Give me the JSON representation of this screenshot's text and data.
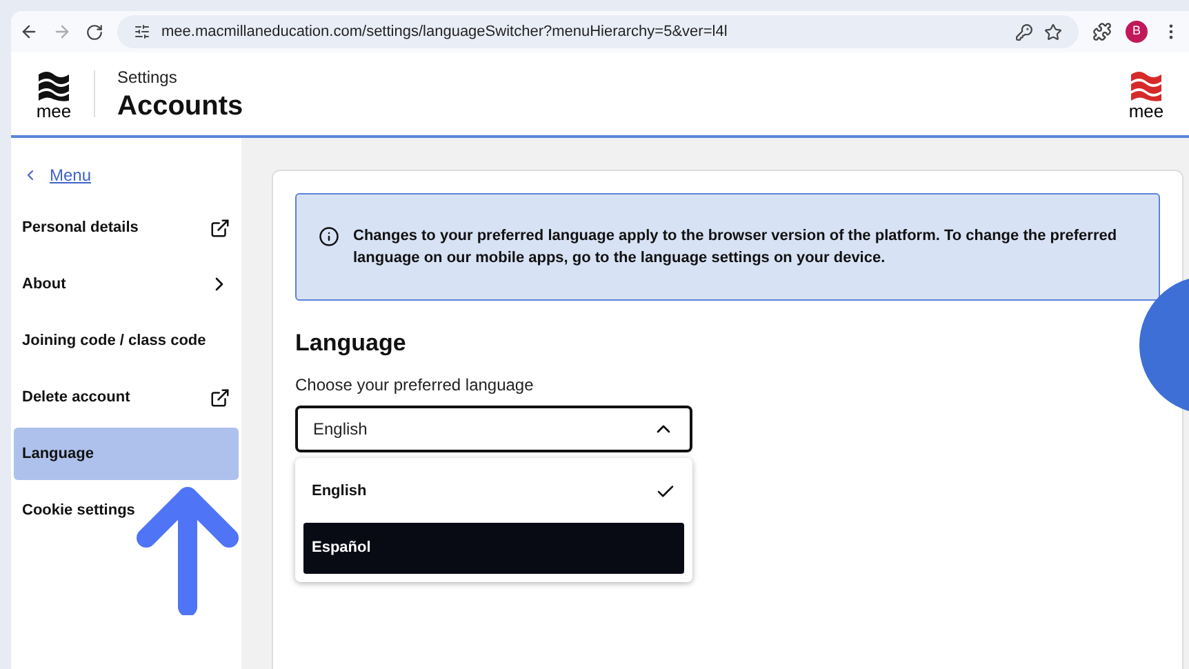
{
  "browser": {
    "url": "mee.macmillaneducation.com/settings/languageSwitcher?menuHierarchy=5&ver=l4l",
    "profile": "B"
  },
  "header": {
    "logo_text": "mee",
    "subtitle": "Settings",
    "title": "Accounts",
    "brand_text": "mee"
  },
  "sidebar": {
    "back": "Menu",
    "items": [
      {
        "label": "Personal details",
        "kind": "external",
        "selected": false
      },
      {
        "label": "About",
        "kind": "chevron",
        "selected": false
      },
      {
        "label": "Joining code / class code",
        "kind": "plain",
        "selected": false
      },
      {
        "label": "Delete account",
        "kind": "external",
        "selected": false
      },
      {
        "label": "Language",
        "kind": "plain",
        "selected": true
      },
      {
        "label": "Cookie settings",
        "kind": "plain",
        "selected": false
      }
    ]
  },
  "notice": "Changes to your preferred language apply to the browser version of the platform. To change the preferred language on our mobile apps, go to the language settings on your device.",
  "section": {
    "title": "Language",
    "label": "Choose your preferred language",
    "select": {
      "value": "English",
      "expanded": true,
      "options": [
        {
          "label": "English",
          "checked": true,
          "highlighted": false
        },
        {
          "label": "Español",
          "checked": false,
          "highlighted": true
        }
      ]
    }
  }
}
